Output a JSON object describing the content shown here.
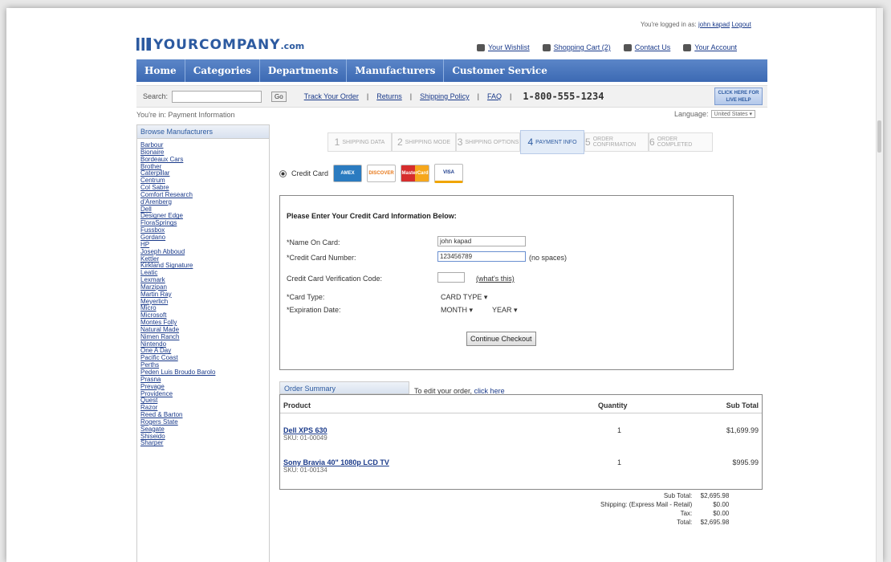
{
  "header": {
    "logged_in": "You're logged in as:",
    "user": "john kapad",
    "logout": "Logout",
    "logo_main": "YOURCOMPANY",
    "logo_domain": ".com",
    "links": [
      "Your Wishlist",
      "Shopping Cart (2)",
      "Contact Us",
      "Your Account"
    ]
  },
  "nav": [
    "Home",
    "Categories",
    "Departments",
    "Manufacturers",
    "Customer Service"
  ],
  "searchbar": {
    "label": "Search:",
    "go": "Go",
    "links": [
      "Track Your Order",
      "Returns",
      "Shipping Policy",
      "FAQ"
    ],
    "phone": "1-800-555-1234",
    "live_help": "CLICK HERE FOR LIVE HELP"
  },
  "breadcrumb": "You're in: Payment Information",
  "language": {
    "label": "Language:",
    "value": "United States"
  },
  "sidebar": {
    "title": "Browse Manufacturers",
    "items": [
      "Barbour",
      "Bionaire",
      "Bordeaux Cars",
      "Brother",
      "Caterpillar",
      "Centrum",
      "Col Sabre",
      "Comfort Research",
      "d'Arenberg",
      "Dell",
      "Designer Edge",
      "FloraSprings",
      "Fussbox",
      "Gordano",
      "HP",
      "Joseph Abboud",
      "Kettler",
      "Kirkland Signature",
      "Leatic",
      "Lexmark",
      "Marzipan",
      "Martin Ray",
      "Meyerlich",
      "Micro",
      "Microsoft",
      "Montes Folly",
      "Natural Made",
      "Nimen Ranch",
      "Nintendo",
      "One A Day",
      "Pacific Coast",
      "Perths",
      "Peden Luis Broudo Barolo",
      "Prasna",
      "Prevage",
      "Providence",
      "Quest",
      "Razor",
      "Reed & Barton",
      "Rogers State",
      "Seagate",
      "Shiseido",
      "Sharper"
    ]
  },
  "steps": [
    {
      "num": "1",
      "label": "SHIPPING DATA"
    },
    {
      "num": "2",
      "label": "SHIPPING MODE"
    },
    {
      "num": "3",
      "label": "SHIPPING OPTIONS"
    },
    {
      "num": "4",
      "label": "PAYMENT INFO"
    },
    {
      "num": "5",
      "label": "ORDER CONFIRMATION"
    },
    {
      "num": "6",
      "label": "ORDER COMPLETED"
    }
  ],
  "payment": {
    "method_label": "Credit Card",
    "cards": [
      "AMEX",
      "DISCOVER",
      "MasterCard",
      "VISA"
    ]
  },
  "form": {
    "title": "Please Enter Your Credit Card Information Below:",
    "name_label": "*Name On Card:",
    "name_value": "john kapad",
    "number_label": "*Credit Card Number:",
    "number_value": "123456789",
    "number_hint": "(no spaces)",
    "cvc_label": "Credit Card Verification Code:",
    "cvc_help": "(what's this)",
    "type_label": "*Card Type:",
    "type_value": "CARD TYPE",
    "exp_label": "*Expiration Date:",
    "month_value": "MONTH",
    "year_value": "YEAR",
    "continue": "Continue Checkout"
  },
  "summary": {
    "tab": "Order Summary",
    "edit_prefix": "To edit your order,",
    "edit_link": "click here",
    "col_product": "Product",
    "col_qty": "Quantity",
    "col_sub": "Sub Total",
    "items": [
      {
        "name": "Dell XPS 630",
        "sku": "SKU: 01-00049",
        "qty": "1",
        "sub": "$1,699.99"
      },
      {
        "name": "Sony Bravia 40\" 1080p LCD TV",
        "sku": "SKU: 01-00134",
        "qty": "1",
        "sub": "$995.99"
      }
    ],
    "subtotal_label": "Sub Total:",
    "subtotal_value": "$2,695.98",
    "shipping_label": "Shipping: (Express Mail - Retail)",
    "shipping_value": "$0.00",
    "tax_label": "Tax:",
    "tax_value": "$0.00",
    "total_label": "Total:",
    "total_value": "$2,695.98"
  }
}
